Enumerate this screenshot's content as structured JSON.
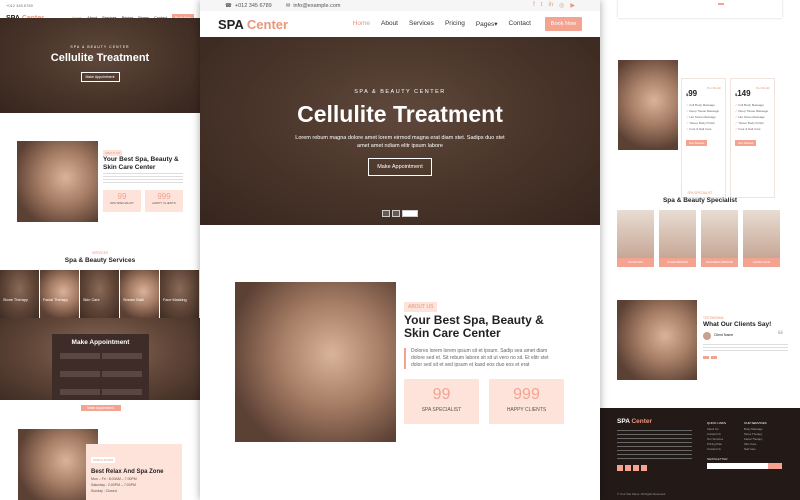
{
  "site": {
    "logo_a": "SPA",
    "logo_b": "Center"
  },
  "topbar": {
    "phone": "+012 345 6789",
    "email": "info@example.com",
    "socials": [
      "f",
      "t",
      "in",
      "◎",
      "▶"
    ]
  },
  "nav": {
    "items": [
      "Home",
      "About",
      "Services",
      "Pricing",
      "Pages",
      "Contact"
    ],
    "book": "Book Now"
  },
  "hero": {
    "subtitle": "SPA & BEAUTY CENTER",
    "title": "Cellulite Treatment",
    "desc": "Lorem rebum magna dolore amet lorem eirmod magna erat diam stet. Sadips duo stet amet amet ndiam elitr ipsum labore",
    "button": "Make Appointment"
  },
  "about": {
    "tag": "ABOUT US",
    "title": "Your Best Spa, Beauty & Skin Care Center",
    "para": "Dolores lorem lorem ipsum sit et ipsum. Sadip sea amet diam dolore sed et. Sit rebum labore sit sit ut vero no sit. Et elitr stet dolor sed sit et sed ipsum et kasd eos duo eos et erat",
    "stats": [
      {
        "n": "99",
        "label": "SPA SPECIALIST"
      },
      {
        "n": "999",
        "label": "HAPPY CLIENTS"
      }
    ]
  },
  "services": {
    "kicker": "SERVICES",
    "title": "Spa & Beauty Services",
    "items": [
      "Stone Therapy",
      "Facial Therapy",
      "Skin Care",
      "Stream Bath",
      "Face Masking"
    ]
  },
  "appointment": {
    "title": "Make Appointment",
    "button": "Make Appointment"
  },
  "relax": {
    "tag": "OPEN HOURS",
    "title": "Best Relax And Spa Zone",
    "lines": [
      "Mon – Fri : 8:00AM – 7:00PM",
      "Saturday : 2:00PM – 7:00PM",
      "Sunday : Closed"
    ]
  },
  "pricing": {
    "plans": [
      {
        "price": "99",
        "per": "Per Month",
        "features": [
          "Full Body Massage",
          "Deep Tissue Massage",
          "Hot Stone Massage",
          "Tissue Body Polish",
          "Foot & Nail Care"
        ],
        "button": "Get Started"
      },
      {
        "price": "149",
        "per": "Per Month",
        "features": [
          "Full Body Massage",
          "Deep Tissue Massage",
          "Hot Stone Massage",
          "Tissue Body Polish",
          "Foot & Nail Care"
        ],
        "button": "Get Started"
      }
    ]
  },
  "specialists": {
    "kicker": "SPA SPECIALIST",
    "title": "Spa & Beauty Specialist",
    "people": [
      "OLIVIA MAY",
      "CLARA BROWN",
      "ELIZABETH BROWN",
      "LAURA JULIA"
    ]
  },
  "testimonial": {
    "kicker": "TESTIMONIAL",
    "title": "What Our Clients Say!",
    "client": "Client Name"
  },
  "footer": {
    "cols": [
      {
        "head": "QUICK LINKS",
        "items": [
          "About Us",
          "Contact Us",
          "Our Services",
          "Pricing Plan",
          "Contact Us"
        ]
      },
      {
        "head": "OUR SERVICES",
        "items": [
          "Body Massage",
          "Stone Therapy",
          "Facial Therapy",
          "Skin Care",
          "Nail Care"
        ]
      }
    ],
    "newsletter": "NEWSLETTER",
    "copy": "© Your Site Name. All Rights Reserved."
  },
  "colors": {
    "accent": "#f4a391",
    "accent_text": "#e9967a",
    "pale": "#fde3da"
  }
}
